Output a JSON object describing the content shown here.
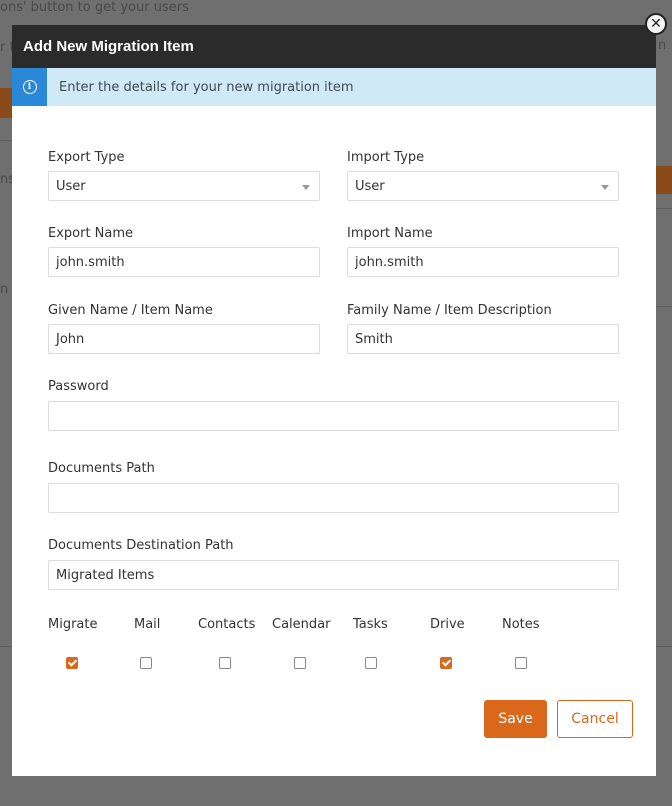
{
  "background": {
    "hint_text": "ons' button to get your users",
    "fragment_r": "r t",
    "fragment_m": "m",
    "fragment_ns": "ns",
    "fragment_n": "n",
    "fragment_right_n": "n"
  },
  "dialog": {
    "title": "Add New Migration Item",
    "info_text": "Enter the details for your new migration item",
    "close_glyph": "✕"
  },
  "form": {
    "export_type": {
      "label": "Export Type",
      "value": "User"
    },
    "import_type": {
      "label": "Import Type",
      "value": "User"
    },
    "export_name": {
      "label": "Export Name",
      "value": "john.smith"
    },
    "import_name": {
      "label": "Import Name",
      "value": "john.smith"
    },
    "given_name": {
      "label": "Given Name / Item Name",
      "value": "John"
    },
    "family_name": {
      "label": "Family Name / Item Description",
      "value": "Smith"
    },
    "password": {
      "label": "Password",
      "value": ""
    },
    "documents_path": {
      "label": "Documents Path",
      "value": ""
    },
    "documents_destination_path": {
      "label": "Documents Destination Path",
      "value": "Migrated Items"
    }
  },
  "checkboxes": [
    {
      "label": "Migrate",
      "checked": true
    },
    {
      "label": "Mail",
      "checked": false
    },
    {
      "label": "Contacts",
      "checked": false
    },
    {
      "label": "Calendar",
      "checked": false
    },
    {
      "label": "Tasks",
      "checked": false
    },
    {
      "label": "Drive",
      "checked": true
    },
    {
      "label": "Notes",
      "checked": false
    }
  ],
  "buttons": {
    "save": "Save",
    "cancel": "Cancel"
  },
  "colors": {
    "accent": "#d9681b",
    "header": "#2b2b2b",
    "info_bar": "#cfe9f6",
    "info_icon": "#2a88d8"
  }
}
